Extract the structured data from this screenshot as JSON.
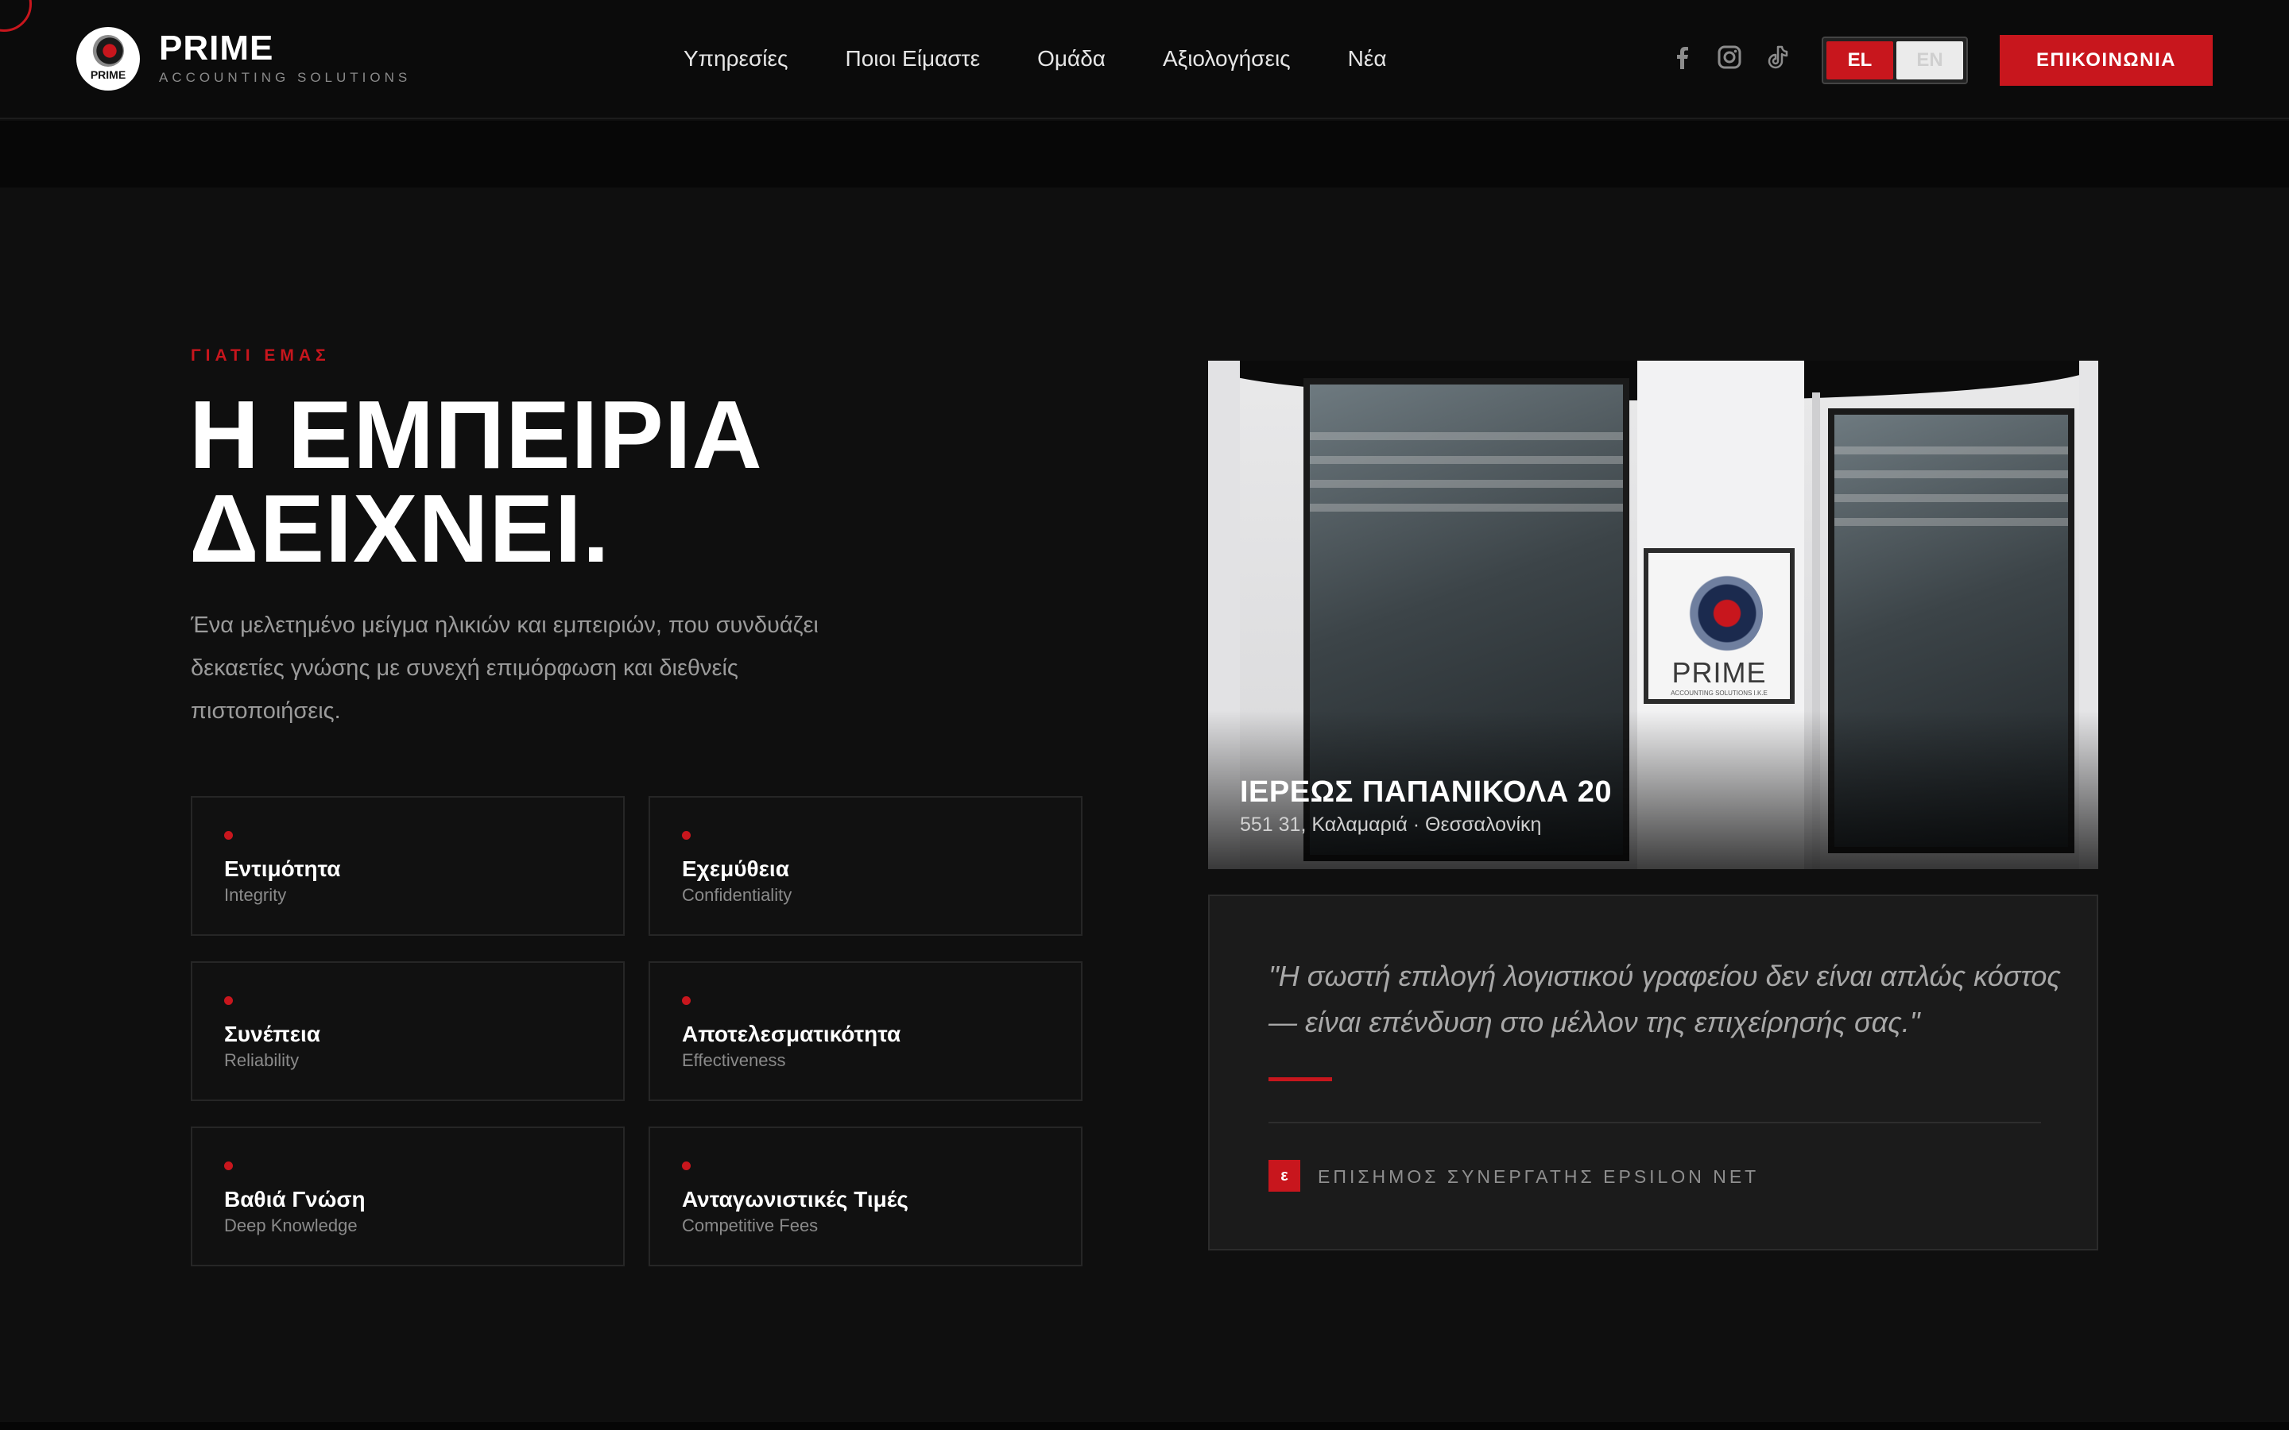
{
  "header": {
    "brand_name": "PRIME",
    "brand_tagline": "ACCOUNTING SOLUTIONS",
    "logo_text": "PRIME",
    "nav": [
      {
        "label": "Υπηρεσίες"
      },
      {
        "label": "Ποιοι Είμαστε"
      },
      {
        "label": "Ομάδα"
      },
      {
        "label": "Αξιολογήσεις"
      },
      {
        "label": "Νέα"
      }
    ],
    "social_icons": [
      "facebook-icon",
      "instagram-icon",
      "tiktok-icon"
    ],
    "lang": {
      "el": "EL",
      "en": "EN",
      "active": "EL"
    },
    "contact_label": "ΕΠΙΚΟΙΝΩΝΙΑ"
  },
  "why": {
    "eyebrow": "ΓΙΑΤΙ ΕΜΑΣ",
    "headline_line1": "Η ΕΜΠΕΙΡΙΑ",
    "headline_line2": "ΔΕΙΧΝΕΙ.",
    "lead": "Ένα μελετημένο μείγμα ηλικιών και εμπειριών, που συνδυάζει δεκαετίες γνώσης με συνεχή επιμόρφωση και διεθνείς πιστοποιήσεις.",
    "values": [
      {
        "title": "Εντιμότητα",
        "subtitle": "Integrity"
      },
      {
        "title": "Εχεμύθεια",
        "subtitle": "Confidentiality"
      },
      {
        "title": "Συνέπεια",
        "subtitle": "Reliability"
      },
      {
        "title": "Αποτελεσματικότητα",
        "subtitle": "Effectiveness"
      },
      {
        "title": "Βαθιά Γνώση",
        "subtitle": "Deep Knowledge"
      },
      {
        "title": "Ανταγωνιστικές Τιμές",
        "subtitle": "Competitive Fees"
      }
    ]
  },
  "office": {
    "address_line1": "ΙΕΡΕΩΣ ΠΑΠΑΝΙΚΟΛΑ 20",
    "address_line2": "551 31, Καλαμαριά · Θεσσαλονίκη",
    "sign_text": "PRIME",
    "sign_small": "ACCOUNTING SOLUTIONS I.K.E"
  },
  "quote": {
    "text": "\"Η σωστή επιλογή λογιστικού γραφείου δεν είναι απλώς κόστος — είναι επένδυση στο μέλλον της επιχείρησής σας.\"",
    "partner_badge": "ε",
    "partner_text": "ΕΠΙΣΗΜΟΣ ΣΥΝΕΡΓΑΤΗΣ EPSILON NET"
  },
  "colors": {
    "accent": "#c8161d",
    "background": "#0f0f0f",
    "card": "#111111"
  }
}
